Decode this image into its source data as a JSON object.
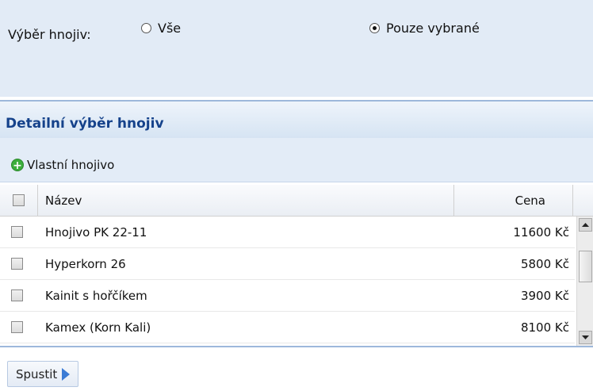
{
  "filter": {
    "label": "Výběr hnojiv:",
    "options": [
      {
        "label": "Vše",
        "checked": false
      },
      {
        "label": "Pouze vybrané",
        "checked": true
      }
    ]
  },
  "section": {
    "title": "Detailní výběr hnojiv"
  },
  "toolbar": {
    "add_label": "Vlastní hnojivo",
    "add_icon": "add-circle-icon"
  },
  "grid": {
    "columns": {
      "name": "Název",
      "price": "Cena"
    },
    "rows": [
      {
        "name": "Hnojivo PK 22-11",
        "price": "11600 Kč"
      },
      {
        "name": "Hyperkorn 26",
        "price": "5800 Kč"
      },
      {
        "name": "Kainit s hořčíkem",
        "price": "3900 Kč"
      },
      {
        "name": "Kamex (Korn Kali)",
        "price": "8100 Kč"
      }
    ]
  },
  "actions": {
    "run_label": "Spustit",
    "run_icon": "play-arrow-icon"
  },
  "colors": {
    "accent": "#15428b",
    "panel": "#e2ebf6",
    "add_green": "#3cae3c",
    "run_arrow": "#3a7bd5"
  }
}
